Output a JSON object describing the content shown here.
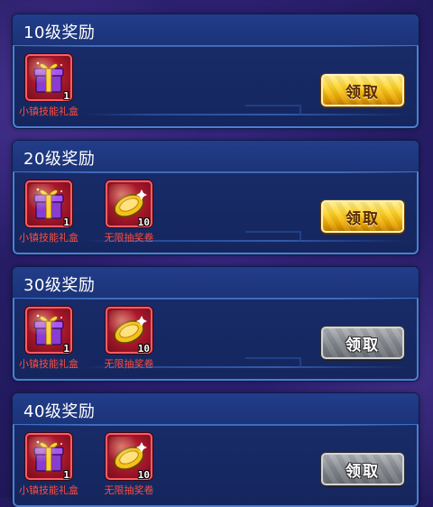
{
  "tiers": [
    {
      "title": "10级奖励",
      "button": {
        "label": "领取",
        "state": "active"
      },
      "items": [
        {
          "icon": "gift-box-icon",
          "count": "1",
          "label": "小镇技能礼盒"
        }
      ]
    },
    {
      "title": "20级奖励",
      "button": {
        "label": "领取",
        "state": "active"
      },
      "items": [
        {
          "icon": "gift-box-icon",
          "count": "1",
          "label": "小镇技能礼盒"
        },
        {
          "icon": "gold-ticket-icon",
          "count": "10",
          "label": "无限抽奖卷"
        }
      ]
    },
    {
      "title": "30级奖励",
      "button": {
        "label": "领取",
        "state": "disabled"
      },
      "items": [
        {
          "icon": "gift-box-icon",
          "count": "1",
          "label": "小镇技能礼盒"
        },
        {
          "icon": "gold-ticket-icon",
          "count": "10",
          "label": "无限抽奖卷"
        }
      ]
    },
    {
      "title": "40级奖励",
      "button": {
        "label": "领取",
        "state": "disabled"
      },
      "items": [
        {
          "icon": "gift-box-icon",
          "count": "1",
          "label": "小镇技能礼盒"
        },
        {
          "icon": "gold-ticket-icon",
          "count": "10",
          "label": "无限抽奖卷"
        }
      ]
    }
  ],
  "colors": {
    "panel_bg": "#182b68",
    "panel_border": "#4c7fd1",
    "item_label": "#ff4d3d",
    "button_active": "#ffd42a",
    "button_disabled": "#8c9096"
  }
}
